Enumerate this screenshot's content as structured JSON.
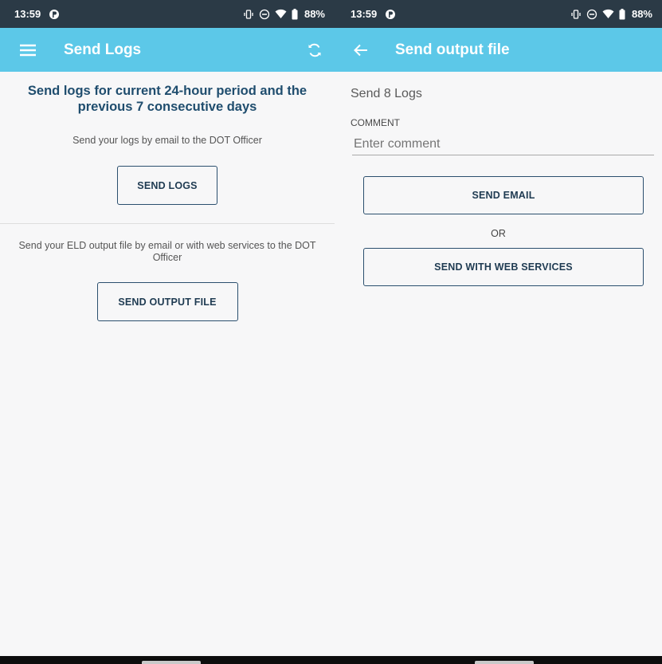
{
  "colors": {
    "status_bar": "#2b3a46",
    "app_bar": "#5cc8e8",
    "heading_text": "#1f4d6e",
    "button_border": "#2b4f6e",
    "background": "#f7f7f8"
  },
  "left": {
    "status": {
      "time": "13:59",
      "battery": "88%"
    },
    "appbar": {
      "title": "Send Logs",
      "icons": [
        "menu-icon",
        "sync-icon"
      ]
    },
    "heading": "Send logs for current 24-hour period and the previous 7 consecutive days",
    "send_logs_hint": "Send your logs by email to the DOT Officer",
    "send_logs_button": "SEND LOGS",
    "output_hint": "Send your ELD output file by email or with web services to the DOT Officer",
    "send_output_button": "SEND OUTPUT FILE"
  },
  "right": {
    "status": {
      "time": "13:59",
      "battery": "88%"
    },
    "appbar": {
      "title": "Send output file",
      "icons": [
        "back-icon"
      ]
    },
    "send_count_label": "Send 8 Logs",
    "comment_label": "COMMENT",
    "comment_placeholder": "Enter comment",
    "comment_value": "",
    "send_email_button": "SEND EMAIL",
    "or_label": "OR",
    "web_services_button": "SEND WITH WEB SERVICES"
  }
}
